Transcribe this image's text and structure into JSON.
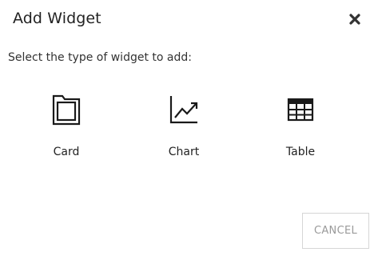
{
  "dialog": {
    "title": "Add Widget",
    "close_icon": "close-icon",
    "prompt": "Select the type of widget to add:",
    "widgets": [
      {
        "label": "Card",
        "icon": "card-icon"
      },
      {
        "label": "Chart",
        "icon": "chart-icon"
      },
      {
        "label": "Table",
        "icon": "table-icon"
      }
    ],
    "cancel_label": "CANCEL"
  },
  "colors": {
    "text": "#222222",
    "muted_button_text": "#9a9a9a",
    "button_border": "#d6d6d6",
    "background": "#ffffff"
  }
}
